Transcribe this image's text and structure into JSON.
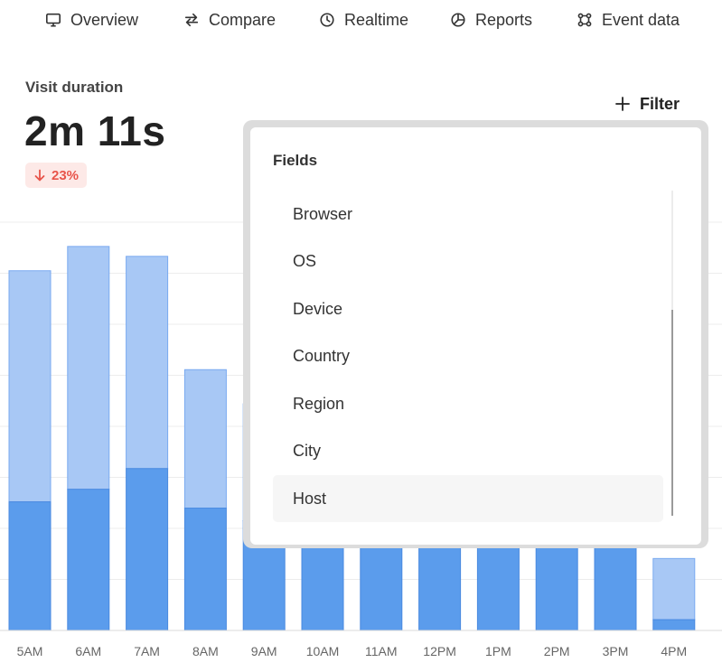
{
  "nav": {
    "items": [
      {
        "label": "Overview",
        "icon": "monitor-icon"
      },
      {
        "label": "Compare",
        "icon": "arrows-swap-icon"
      },
      {
        "label": "Realtime",
        "icon": "clock-icon"
      },
      {
        "label": "Reports",
        "icon": "pie-chart-icon"
      },
      {
        "label": "Event data",
        "icon": "network-icon"
      }
    ]
  },
  "metric": {
    "label": "Visit duration",
    "value": "2m 11s",
    "change": "23%",
    "change_direction": "down",
    "change_color": "#e8544a"
  },
  "filter": {
    "label": "Filter"
  },
  "dropdown": {
    "title": "Fields",
    "items": [
      "Browser",
      "OS",
      "Device",
      "Country",
      "Region",
      "City",
      "Host"
    ],
    "highlighted": "Host"
  },
  "colors": {
    "bar_light": "#a8c8f5",
    "bar_dark": "#5b9cec",
    "accent_red": "#e8544a"
  },
  "chart_data": {
    "type": "bar",
    "stacked": true,
    "categories": [
      "5AM",
      "6AM",
      "7AM",
      "8AM",
      "9AM",
      "10AM",
      "11AM",
      "12PM",
      "1PM",
      "2PM",
      "3PM",
      "4PM"
    ],
    "series": [
      {
        "values": [
          143,
          157,
          180,
          136,
          122,
          108,
          108,
          102,
          102,
          102,
          102,
          12
        ]
      },
      {
        "values": [
          257,
          270,
          236,
          154,
          130,
          120,
          120,
          114,
          114,
          114,
          114,
          68
        ]
      }
    ],
    "ylim": [
      0,
      460
    ],
    "grid": true
  }
}
